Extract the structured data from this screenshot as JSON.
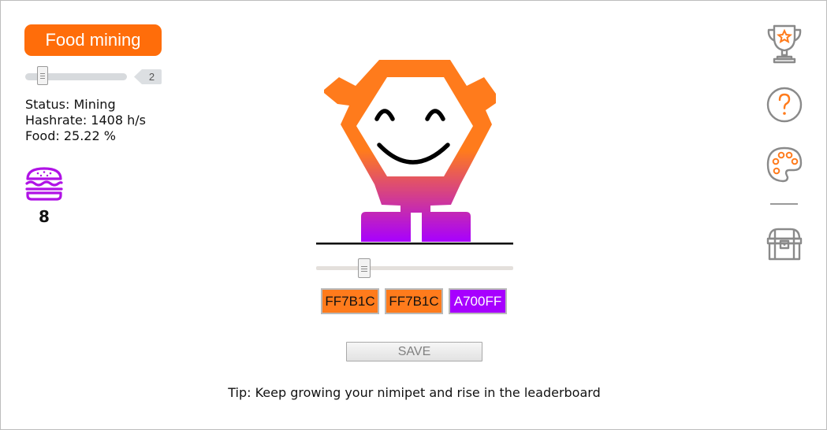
{
  "mining": {
    "button_label": "Food mining",
    "threads": "2",
    "threads_level": 0.2,
    "status_line": "Status: Mining",
    "hashrate_line": "Hashrate: 1408 h/s",
    "food_line": "Food: 25.22 %"
  },
  "inventory": {
    "food_icon": "burger-icon",
    "food_count": "8"
  },
  "pet": {
    "size_slider_level": 0.25,
    "colors": [
      {
        "label": "FF7B1C",
        "hex": "#FF7B1C"
      },
      {
        "label": "FF7B1C",
        "hex": "#FF7B1C"
      },
      {
        "label": "A700FF",
        "hex": "#A700FF"
      }
    ],
    "save_label": "SAVE"
  },
  "tip": "Tip: Keep growing your nimipet and rise in the leaderboard",
  "nav": {
    "icons": [
      "trophy-icon",
      "help-icon",
      "palette-icon",
      "chest-icon"
    ]
  },
  "theme": {
    "accent": "#FF6D0A",
    "icon_orange": "#FF7B1C",
    "icon_gray": "#8A8A8A",
    "food_purple": "#B012E6"
  }
}
